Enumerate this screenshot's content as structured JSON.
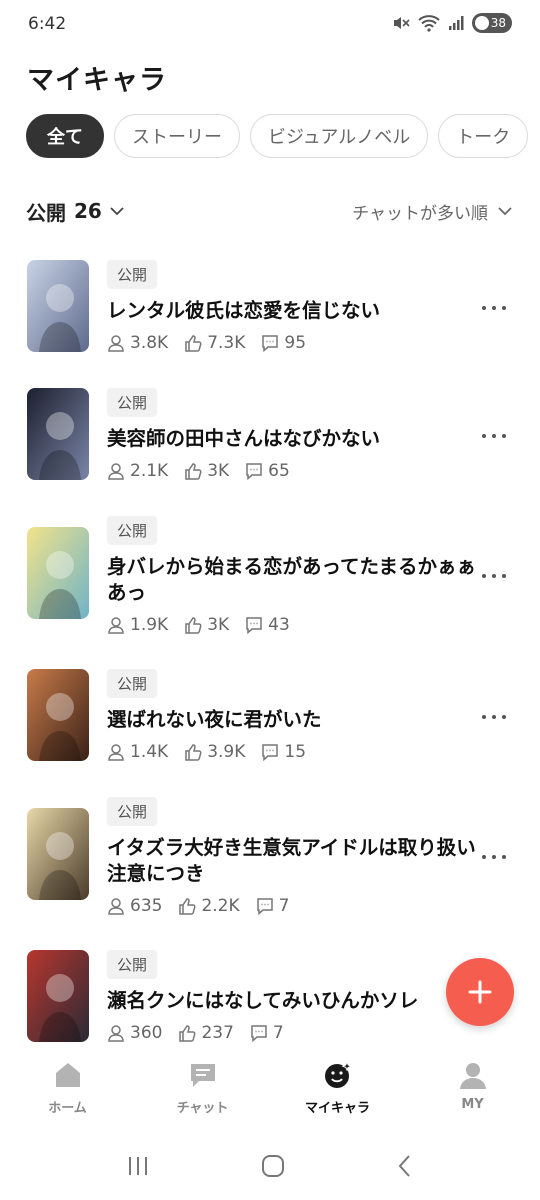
{
  "status_bar": {
    "time": "6:42",
    "battery_level": "38",
    "icons": [
      "mute-icon",
      "wifi-icon",
      "signal-icon",
      "battery-icon"
    ]
  },
  "page": {
    "title": "マイキャラ"
  },
  "filter_tabs": [
    {
      "label": "全て",
      "active": true
    },
    {
      "label": "ストーリー",
      "active": false
    },
    {
      "label": "ビジュアルノベル",
      "active": false
    },
    {
      "label": "トーク",
      "active": false
    }
  ],
  "list_header": {
    "visibility_label": "公開",
    "count": "26",
    "sort_label": "チャットが多い順"
  },
  "characters": [
    {
      "badge": "公開",
      "title": "レンタル彼氏は恋愛を信じない",
      "users": "3.8K",
      "likes": "7.3K",
      "comments": "95",
      "thumb_colors": [
        "#c9d3e6",
        "#5d6a8c"
      ]
    },
    {
      "badge": "公開",
      "title": "美容師の田中さんはなびかない",
      "users": "2.1K",
      "likes": "3K",
      "comments": "65",
      "thumb_colors": [
        "#1d1f2e",
        "#7a86a8"
      ]
    },
    {
      "badge": "公開",
      "title": "身バレから始まる恋があってたまるかぁぁあっ",
      "users": "1.9K",
      "likes": "3K",
      "comments": "43",
      "thumb_colors": [
        "#f2e38a",
        "#6fb3c7"
      ]
    },
    {
      "badge": "公開",
      "title": "選ばれない夜に君がいた",
      "users": "1.4K",
      "likes": "3.9K",
      "comments": "15",
      "thumb_colors": [
        "#c97b4a",
        "#3a2218"
      ]
    },
    {
      "badge": "公開",
      "title": "イタズラ大好き生意気アイドルは取り扱い注意につき",
      "users": "635",
      "likes": "2.2K",
      "comments": "7",
      "thumb_colors": [
        "#e8d8a8",
        "#4a3a2a"
      ]
    },
    {
      "badge": "公開",
      "title": "瀬名クンにはなしてみいひんかソレ",
      "users": "360",
      "likes": "237",
      "comments": "7",
      "thumb_colors": [
        "#b8362e",
        "#2a2a35"
      ]
    }
  ],
  "bottom_nav": [
    {
      "label": "ホーム",
      "icon": "home-icon",
      "active": false
    },
    {
      "label": "チャット",
      "icon": "chat-icon",
      "active": false
    },
    {
      "label": "マイキャラ",
      "icon": "my-character-icon",
      "active": true
    },
    {
      "label": "MY",
      "icon": "profile-icon",
      "active": false
    }
  ],
  "colors": {
    "accent_fab": "#f55e4e",
    "active_chip": "#333333",
    "badge_bg": "#f1f1f1"
  }
}
